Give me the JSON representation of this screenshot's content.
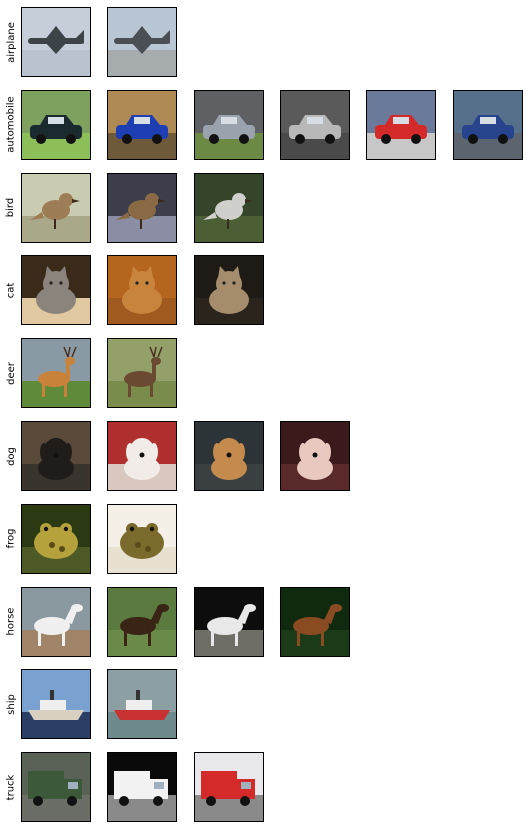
{
  "rows": [
    {
      "label": "airplane",
      "images": [
        {
          "subject": "airplane",
          "sky": "#c6cfd9",
          "ground": "#b8c3cf",
          "main": "#3d4448"
        },
        {
          "subject": "airplane",
          "sky": "#b9c6d3",
          "ground": "#a6abad",
          "main": "#4a4f55"
        }
      ]
    },
    {
      "label": "automobile",
      "images": [
        {
          "subject": "car",
          "sky": "#7fa160",
          "ground": "#8cbf5a",
          "main": "#1b2a2e"
        },
        {
          "subject": "car",
          "sky": "#b08a55",
          "ground": "#6e5a3a",
          "main": "#1d3fb3"
        },
        {
          "subject": "car",
          "sky": "#5f6064",
          "ground": "#6d8a45",
          "main": "#9aa3ad"
        },
        {
          "subject": "car",
          "sky": "#5a5a5a",
          "ground": "#4a4a4a",
          "main": "#b8b8b8"
        },
        {
          "subject": "car",
          "sky": "#6a7a9a",
          "ground": "#c7c7c7",
          "main": "#d42a2a"
        },
        {
          "subject": "car",
          "sky": "#56708c",
          "ground": "#5c6470",
          "main": "#27448c"
        }
      ]
    },
    {
      "label": "bird",
      "images": [
        {
          "subject": "bird",
          "sky": "#c9ccb0",
          "ground": "#a9a98a",
          "main": "#9c7d55"
        },
        {
          "subject": "bird",
          "sky": "#3c3e4c",
          "ground": "#8a8da3",
          "main": "#8a6a45"
        },
        {
          "subject": "bird",
          "sky": "#34452a",
          "ground": "#4b5e34",
          "main": "#cfd0cc"
        }
      ]
    },
    {
      "label": "cat",
      "images": [
        {
          "subject": "cat",
          "sky": "#3a2a1a",
          "ground": "#e0c9a0",
          "main": "#8a847c"
        },
        {
          "subject": "cat",
          "sky": "#b5651d",
          "ground": "#a05a20",
          "main": "#c8843d"
        },
        {
          "subject": "cat",
          "sky": "#1e1a16",
          "ground": "#2a241d",
          "main": "#a48c6c"
        }
      ]
    },
    {
      "label": "deer",
      "images": [
        {
          "subject": "deer",
          "sky": "#8a9aa5",
          "ground": "#5f8a3a",
          "main": "#c8823a"
        },
        {
          "subject": "deer",
          "sky": "#93a06a",
          "ground": "#7a8c4c",
          "main": "#6a4a30"
        }
      ]
    },
    {
      "label": "dog",
      "images": [
        {
          "subject": "dog",
          "sky": "#5a4a3a",
          "ground": "#3a342e",
          "main": "#1f1c1a"
        },
        {
          "subject": "dog",
          "sky": "#b03030",
          "ground": "#d8c8c0",
          "main": "#f2ece8"
        },
        {
          "subject": "dog",
          "sky": "#2c3438",
          "ground": "#3a4042",
          "main": "#c58a4e"
        },
        {
          "subject": "dog",
          "sky": "#3a1a1a",
          "ground": "#5a2a2a",
          "main": "#e9c8c0"
        }
      ]
    },
    {
      "label": "frog",
      "images": [
        {
          "subject": "frog",
          "sky": "#2c3a14",
          "ground": "#4e5a26",
          "main": "#b5a23c"
        },
        {
          "subject": "frog",
          "sky": "#f4f0e8",
          "ground": "#e8e0d0",
          "main": "#7a6a2c"
        }
      ]
    },
    {
      "label": "horse",
      "images": [
        {
          "subject": "horse",
          "sky": "#8a98a0",
          "ground": "#a08468",
          "main": "#f0f0f0"
        },
        {
          "subject": "horse",
          "sky": "#5a7a40",
          "ground": "#6a8a4a",
          "main": "#3a2416"
        },
        {
          "subject": "horse",
          "sky": "#0d0d0d",
          "ground": "#6e6e66",
          "main": "#e8e8e8"
        },
        {
          "subject": "horse",
          "sky": "#0f2a0f",
          "ground": "#1a3a18",
          "main": "#8a4a22"
        }
      ]
    },
    {
      "label": "ship",
      "images": [
        {
          "subject": "ship",
          "sky": "#7aa2d0",
          "ground": "#2a3e66",
          "main": "#d8d0c0"
        },
        {
          "subject": "ship",
          "sky": "#8ca0a4",
          "ground": "#6e8a8c",
          "main": "#c83232"
        }
      ]
    },
    {
      "label": "truck",
      "images": [
        {
          "subject": "truck",
          "sky": "#5a6258",
          "ground": "#6a6e66",
          "main": "#3c5a3a"
        },
        {
          "subject": "truck",
          "sky": "#0a0a0a",
          "ground": "#8a8a8a",
          "main": "#f2f2f2"
        },
        {
          "subject": "truck",
          "sky": "#e8e8ec",
          "ground": "#8a8a8a",
          "main": "#d42a2a"
        }
      ]
    }
  ]
}
